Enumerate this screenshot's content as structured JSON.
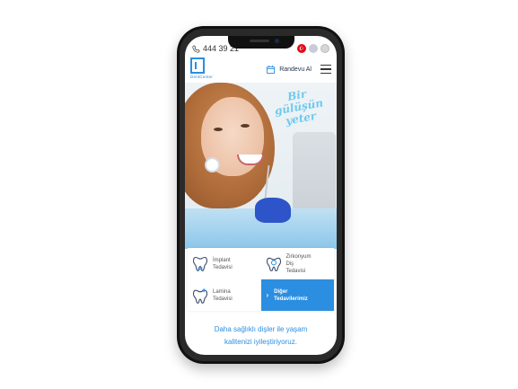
{
  "topbar": {
    "phone": "444 39 21",
    "flag_tr": "☪"
  },
  "header": {
    "logo_text": "DentCenter",
    "appointment_label": "Randevu Al"
  },
  "hero": {
    "slogan_line1": "Bir",
    "slogan_line2": "gülüşün",
    "slogan_line3": "yeter"
  },
  "services": [
    {
      "line1": "İmplant",
      "line2": "Tedavisi"
    },
    {
      "line1": "Zirkonyum",
      "line2": "Diş",
      "line3": "Tedavisi"
    },
    {
      "line1": "Lamina",
      "line2": "Tedavisi"
    },
    {
      "label_line1": "Diğer",
      "label_line2": "Tedavilerimiz",
      "chevron": "›"
    }
  ],
  "tagline": {
    "line1": "Daha sağlıklı dişler ile yaşam",
    "line2": "kalitenizi iyileştiriyoruz."
  },
  "colors": {
    "accent": "#2b8ee0",
    "slogan": "#6fc9ee"
  }
}
